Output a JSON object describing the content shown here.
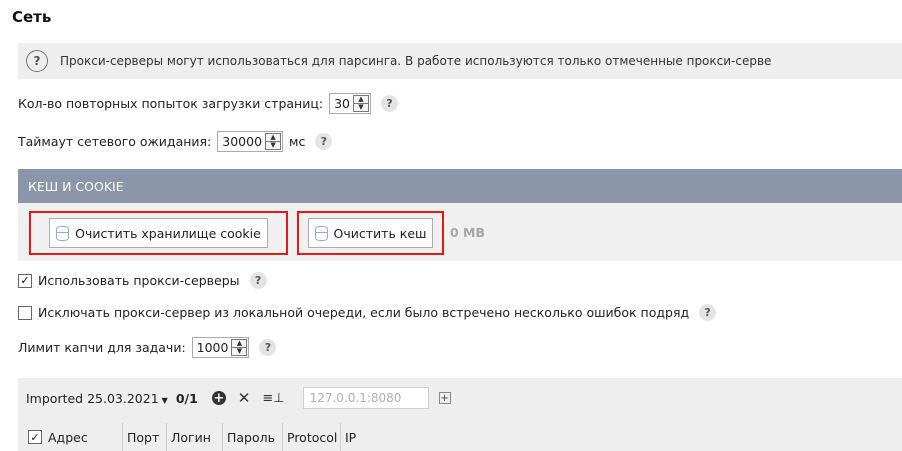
{
  "page": {
    "title": "Сеть"
  },
  "info": {
    "icon": "question-circle-icon",
    "text": "Прокси-серверы могут использоваться для парсинга. В работе используются только отмеченные прокси-серве"
  },
  "retries": {
    "label": "Кол-во повторных попыток загрузки страниц:",
    "value": "30"
  },
  "timeout": {
    "label": "Таймаут сетевого ожидания:",
    "value": "30000",
    "unit": "мс"
  },
  "help_mark": "?",
  "cache_section": {
    "header": "КЕШ И COOKIE",
    "clear_cookie_label": "Очистить хранилище cookie",
    "clear_cache_label": "Очистить кеш",
    "cache_size": "0 MB"
  },
  "use_proxies": {
    "label": "Использовать прокси-серверы",
    "checked": true,
    "mark": "✓"
  },
  "exclude_proxy": {
    "label": "Исключать прокси-сервер из локальной очереди, если было встречено несколько ошибок подряд",
    "checked": false
  },
  "captcha": {
    "label": "Лимит капчи для задачи:",
    "value": "1000"
  },
  "proxy_list": {
    "selected_list": "Imported 25.03.2021",
    "count": "0/1",
    "address_placeholder": "127.0.0.1:8080",
    "columns": [
      "Адрес",
      "Порт",
      "Логин",
      "Пароль",
      "Protocol",
      "IP"
    ],
    "header_checked": true
  },
  "colors": {
    "section_header_bg": "#8b96ab",
    "highlight_border": "#e01919"
  }
}
